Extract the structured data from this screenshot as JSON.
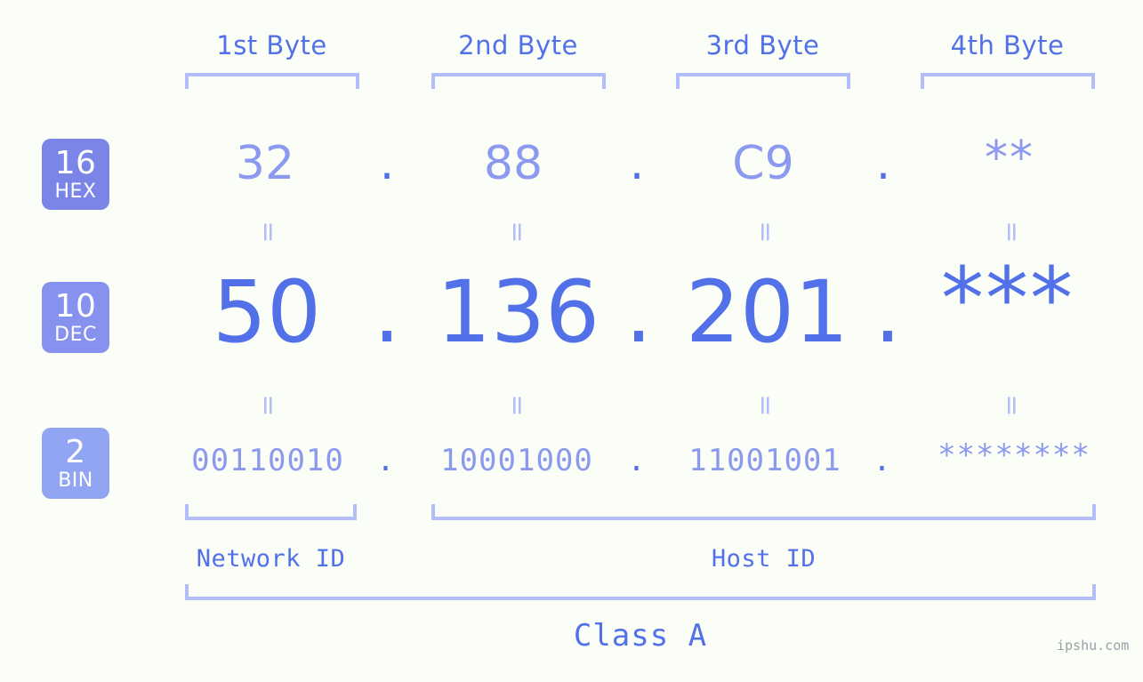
{
  "page": {
    "background_color": "#fbfdf7",
    "accent_color": "#5271e8",
    "light_accent_color": "#8b99ef",
    "bracket_color": "#b3bdfa",
    "watermark": "ipshu.com"
  },
  "headers": [
    {
      "label": "1st Byte"
    },
    {
      "label": "2nd Byte"
    },
    {
      "label": "3rd Byte"
    },
    {
      "label": "4th Byte"
    }
  ],
  "badges": [
    {
      "number": "16",
      "name": "HEX",
      "color": "#7b85e8"
    },
    {
      "number": "10",
      "name": "DEC",
      "color": "#8692ee"
    },
    {
      "number": "2",
      "name": "BIN",
      "color": "#92a5f2"
    }
  ],
  "rows": {
    "hex": {
      "values": [
        "32",
        "88",
        "C9",
        "**"
      ],
      "separator": "."
    },
    "dec": {
      "values": [
        "50",
        "136",
        "201",
        "***"
      ],
      "separator": "."
    },
    "bin": {
      "values": [
        "00110010",
        "10001000",
        "11001001",
        "********"
      ],
      "separator": "."
    }
  },
  "equals_glyph": "=",
  "sections": [
    {
      "label": "Network ID"
    },
    {
      "label": "Host ID"
    }
  ],
  "class": {
    "label": "Class A"
  }
}
